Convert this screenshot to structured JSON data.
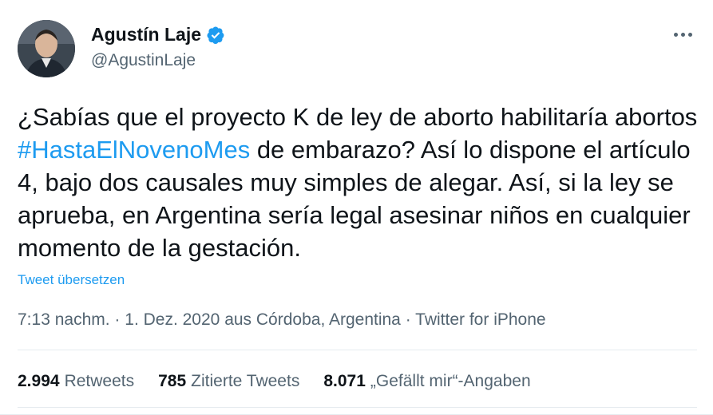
{
  "author": {
    "name": "Agustín Laje",
    "handle": "@AgustinLaje",
    "verified": true
  },
  "tweet": {
    "text_before": "¿Sabías que el proyecto K de ley de aborto habilitaría abortos ",
    "hashtag": "#HastaElNovenoMes",
    "text_after": " de embarazo? Así lo dispone el artículo 4, bajo dos causales muy simples de alegar. Así, si la ley se aprueba, en Argentina sería legal asesinar niños en cualquier momento de la gestación.",
    "translate_label": "Tweet übersetzen",
    "time": "7:13 nachm.",
    "date": "1. Dez. 2020",
    "location": "aus Córdoba, Argentina",
    "source": "Twitter for iPhone",
    "separator": "·"
  },
  "stats": [
    {
      "count": "2.994",
      "label": "Retweets"
    },
    {
      "count": "785",
      "label": "Zitierte Tweets"
    },
    {
      "count": "8.071",
      "label": "„Gefällt mir“-Angaben"
    }
  ],
  "colors": {
    "accent": "#1d9bf0",
    "secondary_text": "#536471",
    "primary_text": "#0f1419"
  }
}
